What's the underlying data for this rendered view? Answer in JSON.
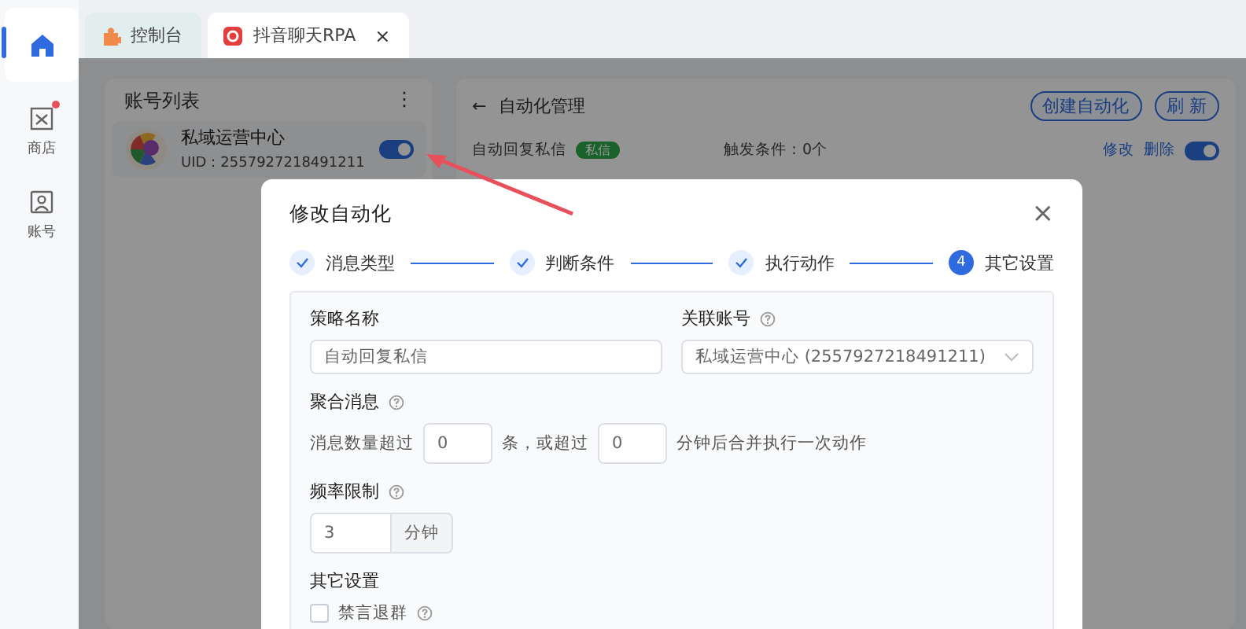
{
  "rail": {
    "items": [
      {
        "kind": "home",
        "selected": true,
        "badge": false
      },
      {
        "kind": "store",
        "label": "商店",
        "selected": false,
        "badge": true
      },
      {
        "kind": "account",
        "label": "账号",
        "selected": false,
        "badge": false
      }
    ]
  },
  "tabs": [
    {
      "label": "控制台",
      "selected": false
    },
    {
      "label": "抖音聊天RPA",
      "selected": true,
      "close": "×"
    }
  ],
  "account_list": {
    "title": "账号列表",
    "menu": "⋮",
    "accounts": [
      {
        "name": "私域运营中心",
        "uid": "UID：2557927218491211",
        "on": true
      }
    ]
  },
  "automation": {
    "back": "←",
    "title": "自动化管理",
    "buttons": [
      "创建自动化",
      "刷 新"
    ],
    "rules": [
      {
        "name": "自动回复私信",
        "tag": "私信",
        "trigger": "触发条件：0个",
        "actions": [
          "修改",
          "删除"
        ],
        "on": true
      }
    ]
  },
  "modal": {
    "title": "修改自动化",
    "close": "×",
    "steps": [
      {
        "label": "消息类型",
        "done": true
      },
      {
        "label": "判断条件",
        "done": true
      },
      {
        "label": "执行动作",
        "done": true
      },
      {
        "label": "其它设置",
        "done": false,
        "number": "4"
      }
    ],
    "strategy_name": {
      "label": "策略名称",
      "value": "自动回复私信"
    },
    "linked_account": {
      "label": "关联账号",
      "help": true,
      "value": "私域运营中心 (2557927218491211)"
    },
    "merge": {
      "label": "聚合消息",
      "help": true,
      "parts": [
        {
          "kind": "text",
          "text": "消息数量超过"
        },
        {
          "kind": "input",
          "value": "0"
        },
        {
          "kind": "text",
          "text": "条，或超过"
        },
        {
          "kind": "input",
          "value": "0"
        },
        {
          "kind": "text",
          "text": "分钟后合并执行一次动作"
        }
      ]
    },
    "rate": {
      "label": "频率限制",
      "help": true,
      "value": "3",
      "unit": "分钟"
    },
    "other": {
      "label": "其它设置",
      "options": [
        {
          "label": "禁言退群",
          "checked": false,
          "help": true
        }
      ]
    }
  }
}
